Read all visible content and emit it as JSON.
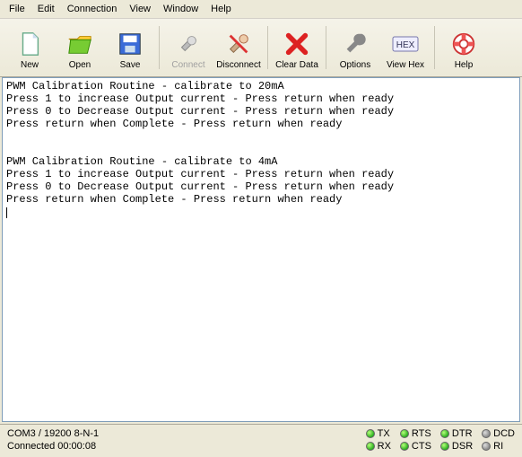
{
  "menu": {
    "items": [
      "File",
      "Edit",
      "Connection",
      "View",
      "Window",
      "Help"
    ]
  },
  "toolbar": {
    "new": "New",
    "open": "Open",
    "save": "Save",
    "connect": "Connect",
    "disconnect": "Disconnect",
    "clear": "Clear Data",
    "options": "Options",
    "viewhex": "View Hex",
    "help": "Help"
  },
  "terminal": {
    "lines": [
      "PWM Calibration Routine - calibrate to 20mA",
      "Press 1 to increase Output current - Press return when ready",
      "Press 0 to Decrease Output current - Press return when ready",
      "Press return when Complete - Press return when ready",
      "",
      "",
      "PWM Calibration Routine - calibrate to 4mA",
      "Press 1 to increase Output current - Press return when ready",
      "Press 0 to Decrease Output current - Press return when ready",
      "Press return when Complete - Press return when ready"
    ]
  },
  "status": {
    "port": "COM3 / 19200 8-N-1",
    "connected": "Connected 00:00:08",
    "leds": [
      {
        "name": "TX",
        "on": true
      },
      {
        "name": "RTS",
        "on": true
      },
      {
        "name": "DTR",
        "on": true
      },
      {
        "name": "DCD",
        "on": false
      },
      {
        "name": "RX",
        "on": true
      },
      {
        "name": "CTS",
        "on": true
      },
      {
        "name": "DSR",
        "on": true
      },
      {
        "name": "RI",
        "on": false
      }
    ]
  },
  "watermark": ""
}
